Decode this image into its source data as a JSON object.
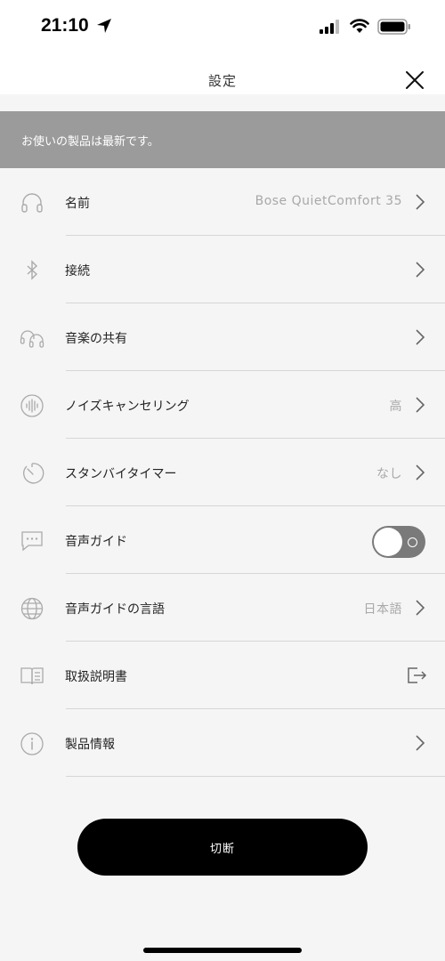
{
  "status_bar": {
    "time": "21:10",
    "icons": [
      "location-arrow-icon",
      "cellular-signal-icon",
      "wifi-icon",
      "battery-icon"
    ]
  },
  "header": {
    "title": "設定",
    "close_icon": "close-icon"
  },
  "banner": {
    "text": "お使いの製品は最新です。"
  },
  "settings": [
    {
      "icon": "headphones-icon",
      "label": "名前",
      "value": "Bose QuietComfort 35",
      "accessory": "chevron"
    },
    {
      "icon": "bluetooth-icon",
      "label": "接続",
      "value": "",
      "accessory": "chevron"
    },
    {
      "icon": "music-share-icon",
      "label": "音楽の共有",
      "value": "",
      "accessory": "chevron"
    },
    {
      "icon": "noise-cancelling-icon",
      "label": "ノイズキャンセリング",
      "value": "高",
      "accessory": "chevron"
    },
    {
      "icon": "standby-timer-icon",
      "label": "スタンバイタイマー",
      "value": "なし",
      "accessory": "chevron"
    },
    {
      "icon": "voice-prompt-icon",
      "label": "音声ガイド",
      "value": "",
      "accessory": "toggle",
      "toggle_on": false
    },
    {
      "icon": "globe-icon",
      "label": "音声ガイドの言語",
      "value": "日本語",
      "accessory": "chevron"
    },
    {
      "icon": "manual-book-icon",
      "label": "取扱説明書",
      "value": "",
      "accessory": "external"
    },
    {
      "icon": "info-icon",
      "label": "製品情報",
      "value": "",
      "accessory": "chevron"
    }
  ],
  "footer": {
    "disconnect_label": "切断"
  }
}
